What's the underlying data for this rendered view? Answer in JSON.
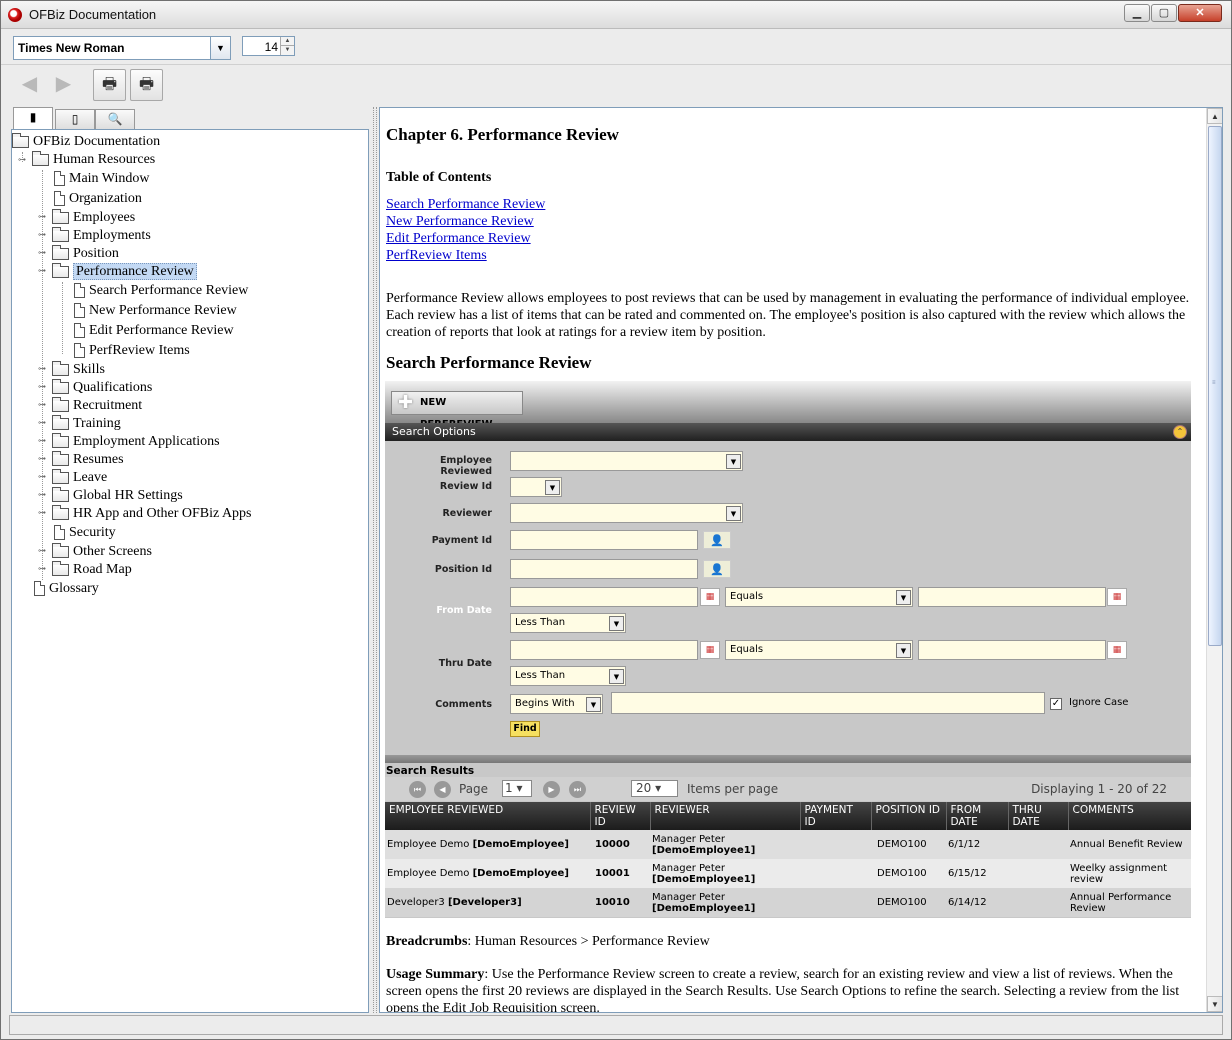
{
  "window": {
    "title": "OFBiz Documentation",
    "min": "▁",
    "max": "▢",
    "close": "✕"
  },
  "fontbar": {
    "font_name": "Times New Roman",
    "font_size": "14"
  },
  "toolbar": {
    "back": "◀",
    "forward": "▶",
    "print": "🖶",
    "print_setup": "🖶"
  },
  "tabs": {
    "contents": "▮",
    "index": "▯",
    "search": "🔍"
  },
  "tree": {
    "root": "OFBiz Documentation",
    "hr": "Human Resources",
    "items": [
      "Main Window",
      "Organization",
      "Employees",
      "Employments",
      "Position",
      "Performance Review",
      "Search Performance Review",
      "New Performance Review",
      "Edit Performance Review",
      "PerfReview Items",
      "Skills",
      "Qualifications",
      "Recruitment",
      "Training",
      "Employment Applications",
      "Resumes",
      "Leave",
      "Global HR Settings",
      "HR App and Other OFBiz Apps",
      "Security",
      "Other Screens",
      "Road Map"
    ],
    "glossary": "Glossary"
  },
  "doc": {
    "chapter_title": "Chapter 6. Performance Review",
    "toc_heading": "Table of Contents",
    "toc": [
      "Search Performance Review",
      "New Performance Review",
      "Edit Performance Review",
      "PerfReview Items"
    ],
    "intro": "Performance Review allows employees to post reviews that can be used by management in evaluating the performance of individual employee. Each review has a list of items that can be rated and commented on. The employee's position is also captured with the review which allows the creation of reports that look at ratings for a review item by position.",
    "section_heading": "Search Performance Review",
    "breadcrumbs_label": "Breadcrumbs",
    "breadcrumbs_text": ": Human Resources > Performance Review",
    "usage_label": "Usage Summary",
    "usage_text": ": Use the Performance Review screen to create a review, search for an existing review and view a list of reviews. When the screen opens the first 20 reviews are displayed in the Search Results. Use Search Options to refine the search. Selecting a review from the list opens the Edit Job Requisition screen."
  },
  "shot": {
    "new_button": "NEW PERFREVIEW",
    "search_options": "Search Options",
    "labels": {
      "employee": "Employee Reviewed",
      "review_id": "Review Id",
      "reviewer": "Reviewer",
      "payment_id": "Payment Id",
      "position_id": "Position Id",
      "from_date": "From Date",
      "thru_date": "Thru Date",
      "comments": "Comments"
    },
    "equals": "Equals",
    "less_than": "Less Than",
    "begins_with": "Begins With",
    "ignore_case": "Ignore Case",
    "find": "Find",
    "results_label": "Search Results",
    "pager": {
      "page_label": "Page",
      "page": "1",
      "per_page": "20",
      "items_label": "Items per page",
      "display": "Displaying 1 - 20 of 22"
    },
    "columns": [
      "EMPLOYEE REVIEWED",
      "REVIEW ID",
      "REVIEWER",
      "PAYMENT ID",
      "POSITION ID",
      "FROM DATE",
      "THRU DATE",
      "COMMENTS"
    ],
    "rows": [
      {
        "emp": "Employee Demo",
        "emp_id": "[DemoEmployee]",
        "review_id": "10000",
        "reviewer": "Manager Peter",
        "reviewer_id": "[DemoEmployee1]",
        "payment": "",
        "position": "DEMO100",
        "from": "6/1/12",
        "thru": "",
        "comments": "Annual Benefit Review"
      },
      {
        "emp": "Employee Demo",
        "emp_id": "[DemoEmployee]",
        "review_id": "10001",
        "reviewer": "Manager Peter",
        "reviewer_id": "[DemoEmployee1]",
        "payment": "",
        "position": "DEMO100",
        "from": "6/15/12",
        "thru": "",
        "comments": "Weelky assignment review"
      },
      {
        "emp": "Developer3",
        "emp_id": "[Developer3]",
        "review_id": "10010",
        "reviewer": "Manager Peter",
        "reviewer_id": "[DemoEmployee1]",
        "payment": "",
        "position": "DEMO100",
        "from": "6/14/12",
        "thru": "",
        "comments": "Annual Performance Review"
      }
    ]
  }
}
